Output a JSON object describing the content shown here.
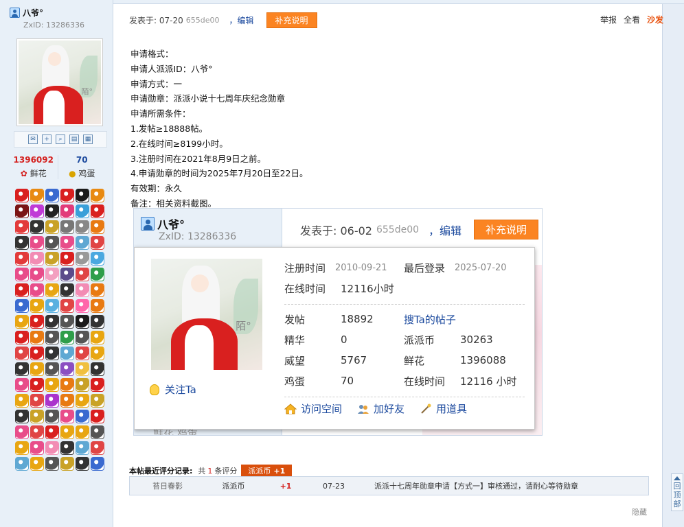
{
  "sidebar": {
    "username": "八爷°",
    "zxid": "ZxID:  13286336",
    "avatar_signature": "陌°",
    "tools": [
      "mail-icon",
      "add-friend-icon",
      "profile-icon",
      "card-icon",
      "blocks-icon"
    ],
    "stats": [
      {
        "value": "1396092",
        "label": "鲜花",
        "color": "#d4211f"
      },
      {
        "value": "70",
        "label": "鸡蛋",
        "color": "#1c4a9e"
      }
    ],
    "medal_colors": [
      "#d9201f",
      "#e88a12",
      "#3a6ad0",
      "#d9201f",
      "#1b1b1b",
      "#e88a12",
      "#7a1515",
      "#c03bd6",
      "#222",
      "#e23b7a",
      "#3aa0d9",
      "#d9201f",
      "#e23b3b",
      "#333",
      "#c9a227",
      "#777",
      "#888",
      "#e87a12",
      "#333",
      "#e84d8a",
      "#555",
      "#e84d8a",
      "#5fa8d3",
      "#e04545",
      "#e23b3b",
      "#f28cb4",
      "#c9a227",
      "#d9201f",
      "#999",
      "#4aa8e0",
      "#e84d8a",
      "#e84d8a",
      "#f3a0c0",
      "#5b4b8a",
      "#e04545",
      "#2e9e4a",
      "#d9201f",
      "#e84d8a",
      "#e8a612",
      "#333",
      "#f28cb4",
      "#e87a12",
      "#3a6ad0",
      "#e8a612",
      "#5ab0e0",
      "#e04545",
      "#ff66aa",
      "#e87a12",
      "#e8a612",
      "#d9201f",
      "#333",
      "#555",
      "#1b1b1b",
      "#333",
      "#d9201f",
      "#e87a12",
      "#555",
      "#2e9e4a",
      "#555",
      "#e8a612",
      "#e04545",
      "#d9201f",
      "#333",
      "#5fa8d3",
      "#e04545",
      "#e8a612",
      "#333",
      "#e8a612",
      "#555",
      "#8b4fc2",
      "#f0c040",
      "#333",
      "#e84d8a",
      "#d9201f",
      "#e8a612",
      "#e87a12",
      "#c9a227",
      "#d9201f",
      "#e8a612",
      "#e04545",
      "#aa33cc",
      "#e87a12",
      "#e8a612",
      "#c9a227",
      "#333",
      "#c9a227",
      "#555",
      "#e84d8a",
      "#3a6ad0",
      "#d9201f",
      "#e84d8a",
      "#e04545",
      "#d9201f",
      "#e8a612",
      "#e8a612",
      "#555",
      "#e8a612",
      "#e84d8a",
      "#f28cb4",
      "#333",
      "#5fa8d3",
      "#e04545",
      "#5fa8d3",
      "#e8a612",
      "#555",
      "#c9a227",
      "#333",
      "#3a6ad0"
    ]
  },
  "post_header": {
    "posted": "发表于: 07-20",
    "hash": "655de00",
    "edit": "，编辑",
    "supplement": "补充说明",
    "report": "举报",
    "view_all": "全看",
    "sofa": "沙发"
  },
  "body_lines": [
    "申请格式：",
    "申请人派派ID：八爷°",
    "申请方式：一",
    "申请勋章：派派小说十七周年庆纪念勋章",
    "申请所需条件：",
    "1.发帖≥18888帖。",
    "2.在线时间≥8199小时。",
    "3.注册时间在2021年8月9日之前。",
    "4.申请勋章的时间为2025年7月20日至22日。",
    "有效期：永久",
    "备注：相关资料截图。"
  ],
  "screenshot": {
    "username": "八爷°",
    "zxid": "ZxID:  13286336",
    "posted": "发表于: 06-02",
    "hash": "655de00",
    "edit": "，编辑",
    "supplement": "补充说明",
    "foot": "鲜花    鸡蛋",
    "card": {
      "avatar_signature": "陌°",
      "follow": "关注Ta",
      "register_label": "注册时间",
      "register_value": "2010-09-21",
      "last_login_label": "最后登录",
      "last_login_value": "2025-07-20",
      "online_label": "在线时间",
      "online_value": "12116小时",
      "rows": [
        {
          "k": "发帖",
          "v": "18892",
          "k2": "搜Ta的帖子",
          "v2": ""
        },
        {
          "k": "精华",
          "v": "0",
          "k2": "派派币",
          "v2": "30263"
        },
        {
          "k": "威望",
          "v": "5767",
          "k2": "鲜花",
          "v2": "1396088"
        },
        {
          "k": "鸡蛋",
          "v": "70",
          "k2": "在线时间",
          "v2": "12116 小时"
        }
      ],
      "actions": [
        {
          "label": "访问空间",
          "icon": "home-icon"
        },
        {
          "label": "加好友",
          "icon": "add-friend-icon"
        },
        {
          "label": "用道具",
          "icon": "wand-icon"
        }
      ]
    }
  },
  "rating": {
    "title": "本帖最近评分记录:",
    "total_prefix": "共",
    "count": "1",
    "total_suffix": "条评分",
    "badge_label": "派派币",
    "badge_value": "+1",
    "row": {
      "user": "苔日春影",
      "type": "派派币",
      "value": "+1",
      "date": "07-23",
      "reason": "派派十七周年勋章申请【方式一】审核通过，请耐心等待勋章"
    }
  },
  "hide": "隐藏",
  "back_top": "回顶部"
}
